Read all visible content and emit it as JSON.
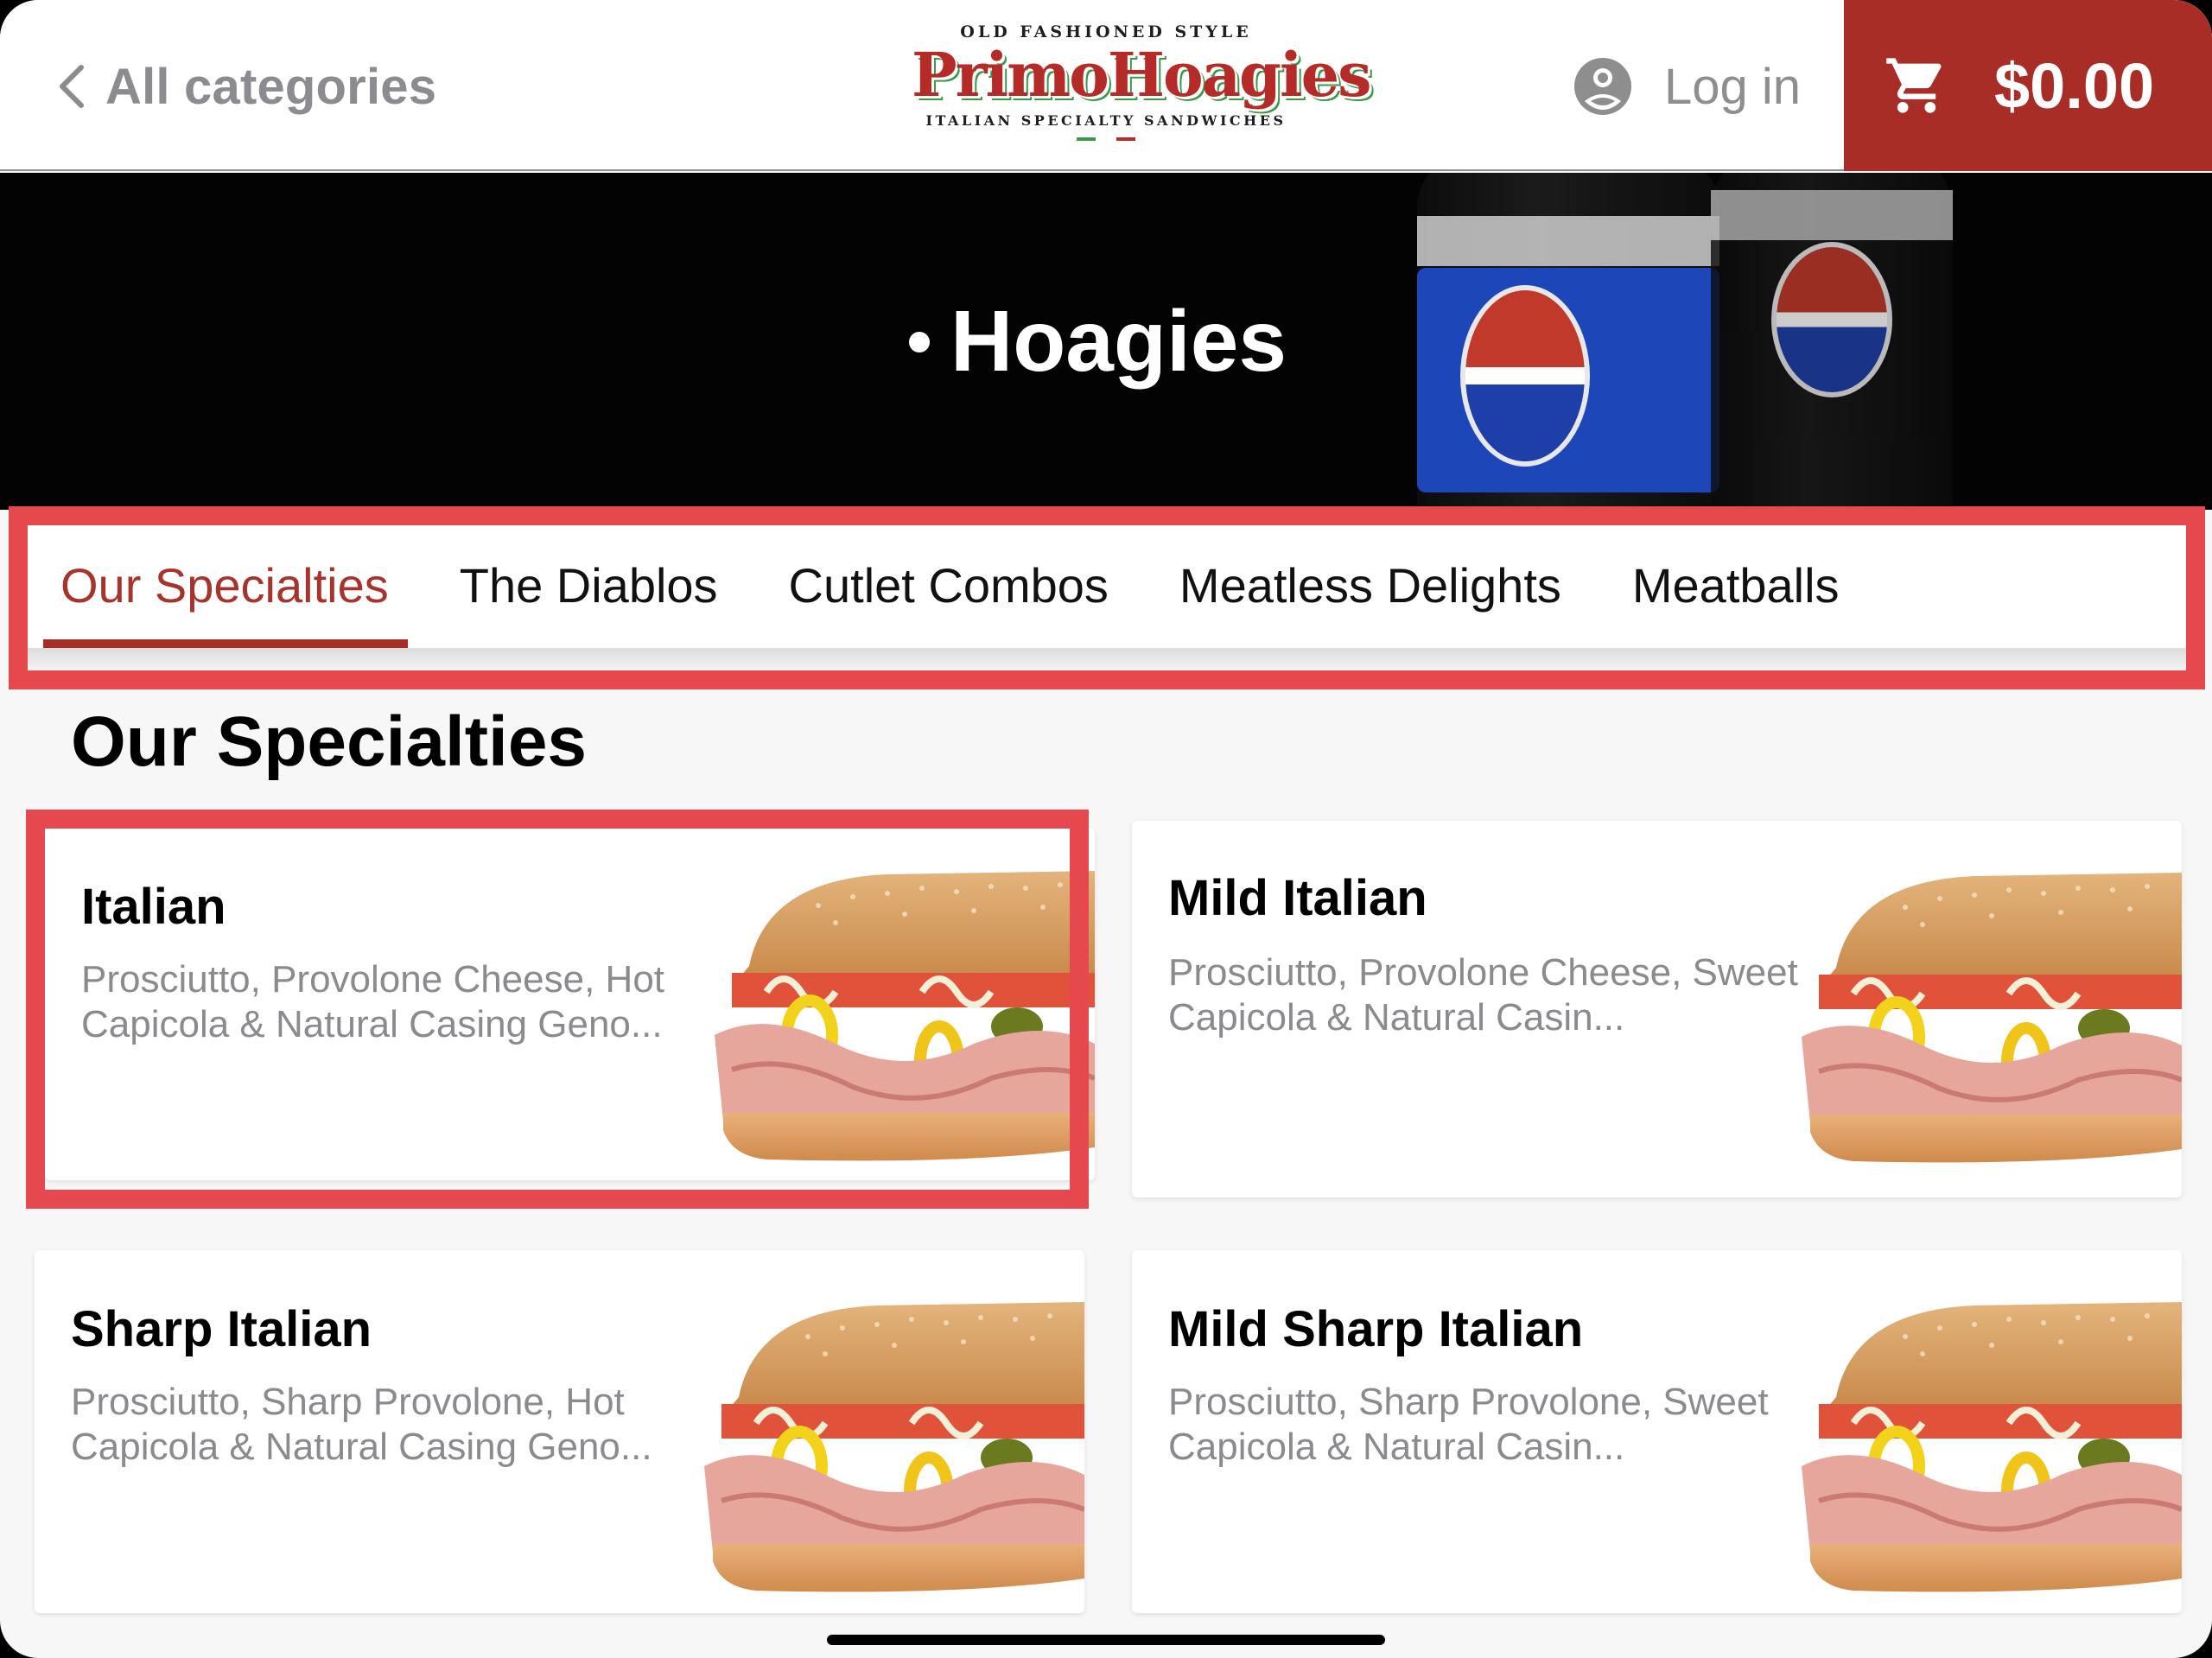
{
  "header": {
    "back_label": "All categories",
    "back_icon": "chevron-left-icon",
    "logo": {
      "tagline_top": "OLD FASHIONED STYLE",
      "brand": "PrimoHoagies",
      "tagline_bottom": "ITALIAN SPECIALTY SANDWICHES",
      "flag_colors": [
        "#3b9a4a",
        "#b52b27"
      ]
    },
    "login_label": "Log in",
    "login_icon": "account-circle-icon",
    "cart_icon": "shopping-cart-icon",
    "cart_total": "$0.00"
  },
  "hero": {
    "title": "Hoagies",
    "background": "pepsi bottles photo"
  },
  "tabs": [
    {
      "label": "Our Specialties",
      "active": true
    },
    {
      "label": "The Diablos",
      "active": false
    },
    {
      "label": "Cutlet Combos",
      "active": false
    },
    {
      "label": "Meatless Delights",
      "active": false
    },
    {
      "label": "Meatballs",
      "active": false
    }
  ],
  "section": {
    "title": "Our Specialties"
  },
  "items": [
    {
      "name": "Italian",
      "description": "Prosciutto, Provolone Cheese, Hot Capicola & Natural Casing Geno..."
    },
    {
      "name": "Mild Italian",
      "description": "Prosciutto, Provolone Cheese, Sweet Capicola & Natural Casin..."
    },
    {
      "name": "Sharp Italian",
      "description": "Prosciutto, Sharp Provolone, Hot Capicola & Natural Casing Geno..."
    },
    {
      "name": "Mild Sharp Italian",
      "description": "Prosciutto, Sharp Provolone, Sweet Capicola & Natural Casin..."
    }
  ],
  "colors": {
    "brand_red": "#a82d26",
    "highlight": "#e5484d",
    "muted_text": "#8a8a8f"
  }
}
